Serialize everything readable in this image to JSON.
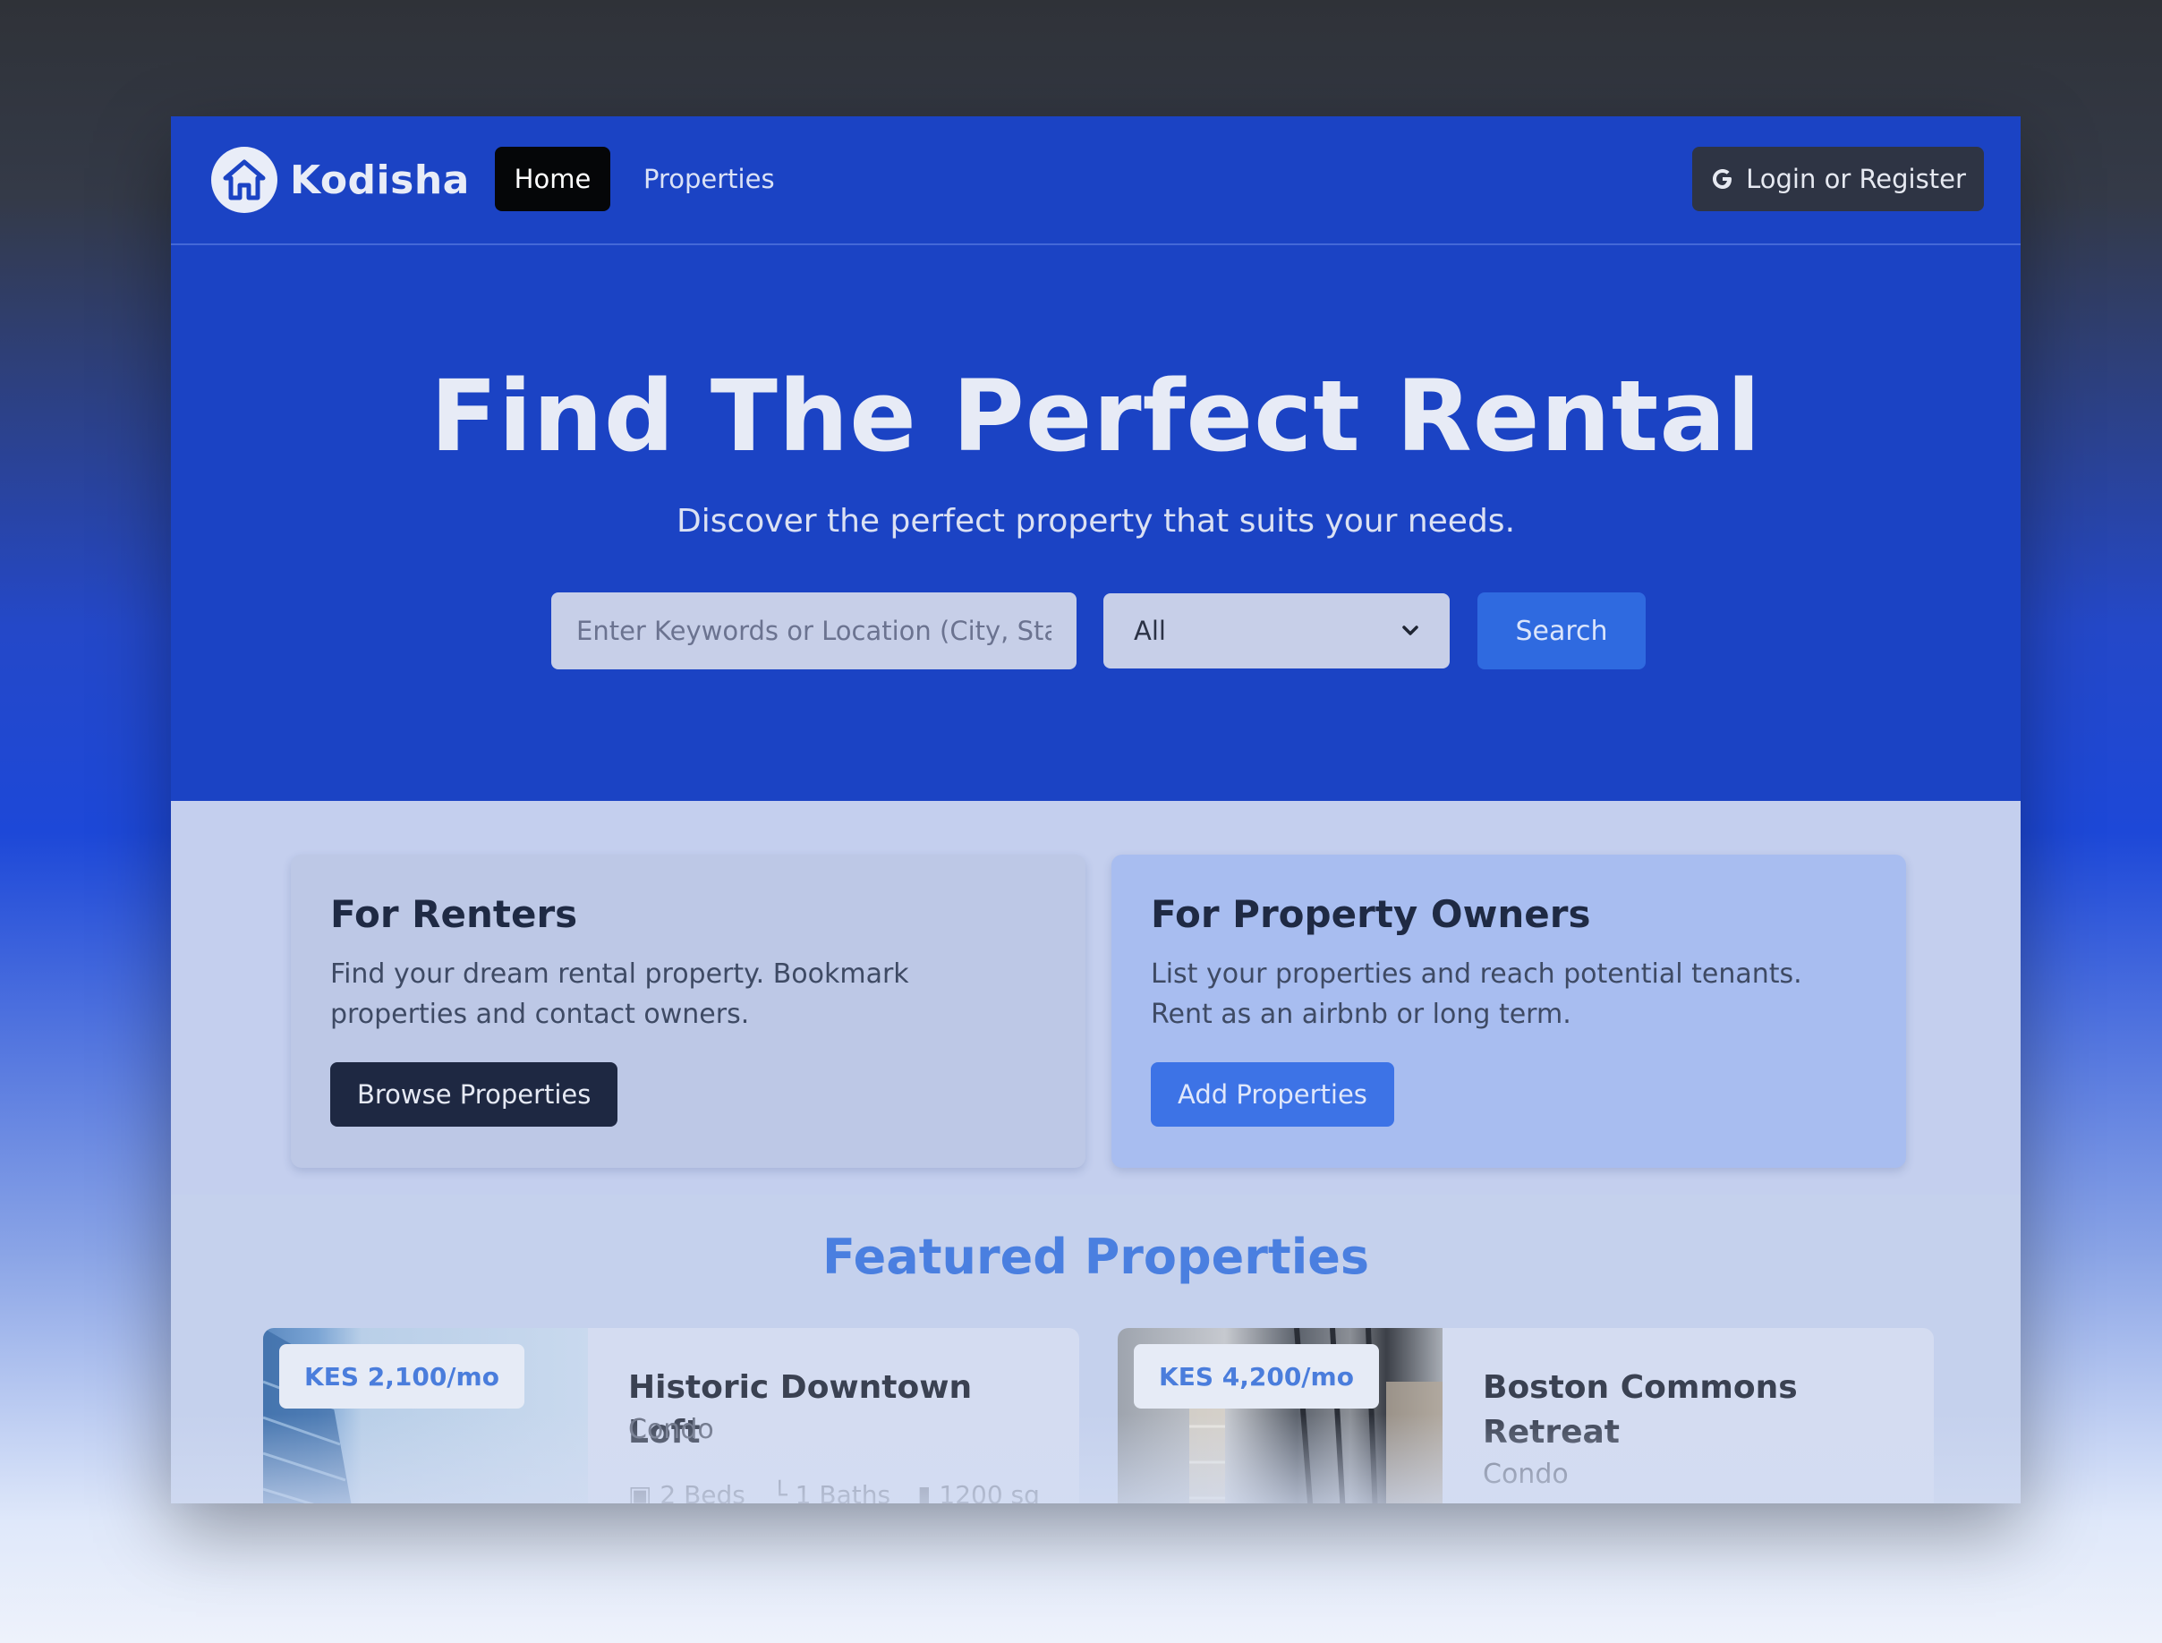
{
  "nav": {
    "brand": "Kodisha",
    "home_label": "Home",
    "properties_label": "Properties",
    "login_label": "Login or Register",
    "login_icon": "google-icon",
    "logo_icon": "house-icon"
  },
  "hero": {
    "title": "Find The Perfect Rental",
    "subtitle": "Discover the perfect property that suits your needs.",
    "search_placeholder": "Enter Keywords or Location (City, State)",
    "search_value": "",
    "category_selected": "All",
    "search_button": "Search"
  },
  "cards": {
    "renters": {
      "title": "For Renters",
      "text": "Find your dream rental property. Bookmark properties and contact owners.",
      "button": "Browse Properties"
    },
    "owners": {
      "title": "For Property Owners",
      "text": "List your properties and reach potential tenants. Rent as an airbnb or long term.",
      "button": "Add Properties"
    }
  },
  "featured": {
    "title": "Featured Properties",
    "items": [
      {
        "price": "KES 2,100/mo",
        "title": "Historic Downtown Loft",
        "type": "Condo",
        "beds": "2 Beds",
        "baths": "1 Baths",
        "area": "1200 sq"
      },
      {
        "price": "KES 4,200/mo",
        "title": "Boston Commons Retreat",
        "type": "Condo"
      }
    ]
  },
  "colors": {
    "hero_bg": "#1b43c4",
    "accent": "#2f6ae0",
    "featured_title": "#4a7fe0"
  }
}
